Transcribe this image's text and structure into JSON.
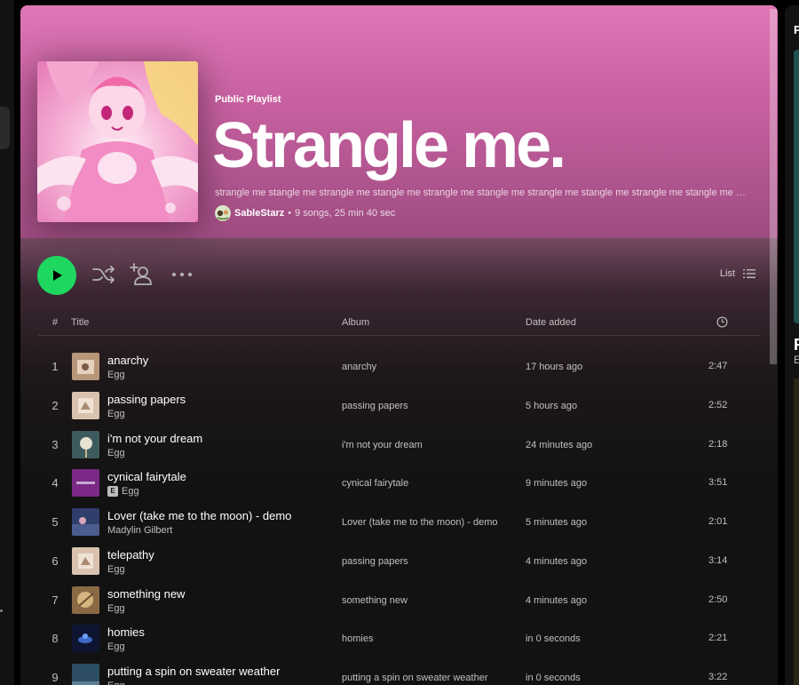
{
  "playlist": {
    "kind": "Public Playlist",
    "title": "Strangle me.",
    "description": "strangle me stangle me strangle me stangle me strangle me stangle me strangle me stangle me strangle me stangle me strangle me stangle me",
    "owner": "SableStarz",
    "meta": "9 songs, 25 min 40 sec",
    "meta_separator": "•"
  },
  "actions": {
    "play_icon": "play-icon",
    "shuffle_icon": "shuffle-icon",
    "add_user_icon": "add-user-icon",
    "more_icon": "more-horizontal-icon",
    "view_label": "List",
    "view_icon": "list-icon"
  },
  "table": {
    "headers": {
      "num": "#",
      "title": "Title",
      "album": "Album",
      "date": "Date added",
      "duration_icon": "clock-icon"
    },
    "rows": [
      {
        "num": "1",
        "title": "anarchy",
        "artist": "Egg",
        "explicit": false,
        "album": "anarchy",
        "date": "17 hours ago",
        "duration": "2:47"
      },
      {
        "num": "2",
        "title": "passing papers",
        "artist": "Egg",
        "explicit": false,
        "album": "passing papers",
        "date": "5 hours ago",
        "duration": "2:52"
      },
      {
        "num": "3",
        "title": "i'm not your dream",
        "artist": "Egg",
        "explicit": false,
        "album": "i'm not your dream",
        "date": "24 minutes ago",
        "duration": "2:18"
      },
      {
        "num": "4",
        "title": "cynical fairytale",
        "artist": "Egg",
        "explicit": true,
        "explicit_label": "E",
        "album": "cynical fairytale",
        "date": "9 minutes ago",
        "duration": "3:51"
      },
      {
        "num": "5",
        "title": "Lover (take me to the moon) - demo",
        "artist": "Madylin Gilbert",
        "explicit": false,
        "album": "Lover (take me to the moon) - demo",
        "date": "5 minutes ago",
        "duration": "2:01"
      },
      {
        "num": "6",
        "title": "telepathy",
        "artist": "Egg",
        "explicit": false,
        "album": "passing papers",
        "date": "4 minutes ago",
        "duration": "3:14"
      },
      {
        "num": "7",
        "title": "something new",
        "artist": "Egg",
        "explicit": false,
        "album": "something new",
        "date": "4 minutes ago",
        "duration": "2:50"
      },
      {
        "num": "8",
        "title": "homies",
        "artist": "Egg",
        "explicit": false,
        "album": "homies",
        "date": "in 0 seconds",
        "duration": "2:21"
      },
      {
        "num": "9",
        "title": "putting a spin on sweater weather",
        "artist": "Egg",
        "explicit": false,
        "album": "putting a spin on sweater weather",
        "date": "in 0 seconds",
        "duration": "3:22"
      }
    ]
  },
  "right_panel": {
    "letter_top": "P",
    "letter_mid": "R",
    "letter_sub": "E"
  },
  "colors": {
    "accent_green": "#1ed760",
    "header_pink": "#de77b6",
    "background": "#121212"
  }
}
